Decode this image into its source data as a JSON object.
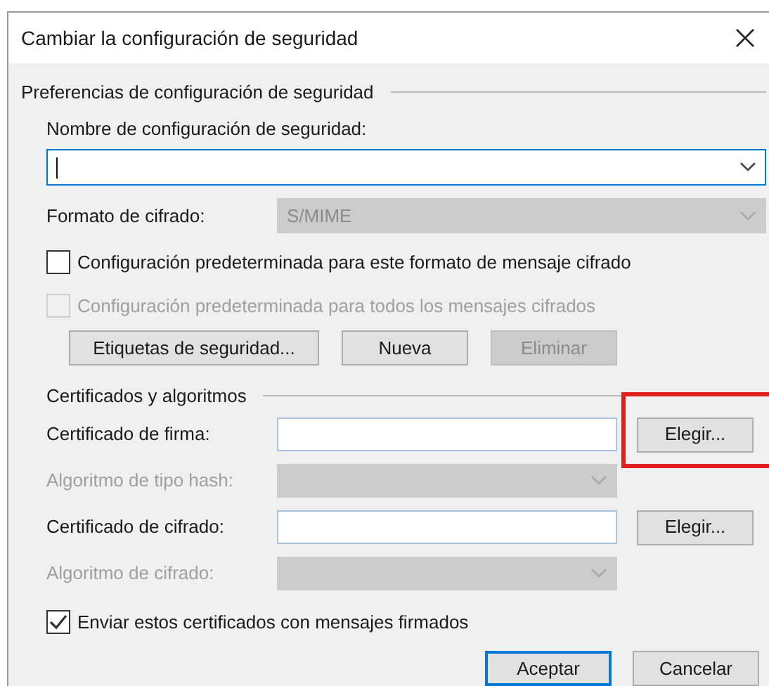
{
  "window": {
    "title": "Cambiar la configuración de seguridad"
  },
  "preferences": {
    "title": "Preferencias de configuración de seguridad",
    "name_field": {
      "label": "Nombre de configuración de seguridad:",
      "focused": true
    },
    "format": {
      "label": "Formato de cifrado:",
      "value": "S/MIME",
      "disabled": true
    },
    "checkboxes": [
      {
        "label": "Configuración predeterminada para este formato de mensaje cifrado",
        "checked": false,
        "disabled": false
      },
      {
        "label": "Configuración predeterminada para todos los mensajes cifrados",
        "checked": false,
        "disabled": true
      }
    ],
    "buttons": [
      {
        "label": "Etiquetas de seguridad...",
        "disabled": false
      },
      {
        "label": "Nueva",
        "disabled": false
      },
      {
        "label": "Eliminar",
        "disabled": true
      }
    ]
  },
  "certificates": {
    "title": "Certificados y algoritmos",
    "rows": [
      {
        "kind": "field",
        "label": "Certificado de firma:",
        "disabled": false,
        "button": {
          "label": "Elegir...",
          "highlighted": true
        }
      },
      {
        "kind": "select",
        "label": "Algoritmo de tipo hash:",
        "disabled": true
      },
      {
        "kind": "field",
        "label": "Certificado de cifrado:",
        "disabled": false,
        "button": {
          "label": "Elegir...",
          "highlighted": false
        }
      },
      {
        "kind": "select",
        "label": "Algoritmo de cifrado:",
        "disabled": true
      }
    ]
  },
  "send_checkbox": {
    "label": "Enviar estos certificados con mensajes firmados",
    "checked": true
  },
  "footer_buttons": [
    {
      "label": "Aceptar",
      "default": true
    },
    {
      "label": "Cancelar",
      "default": false
    }
  ]
}
